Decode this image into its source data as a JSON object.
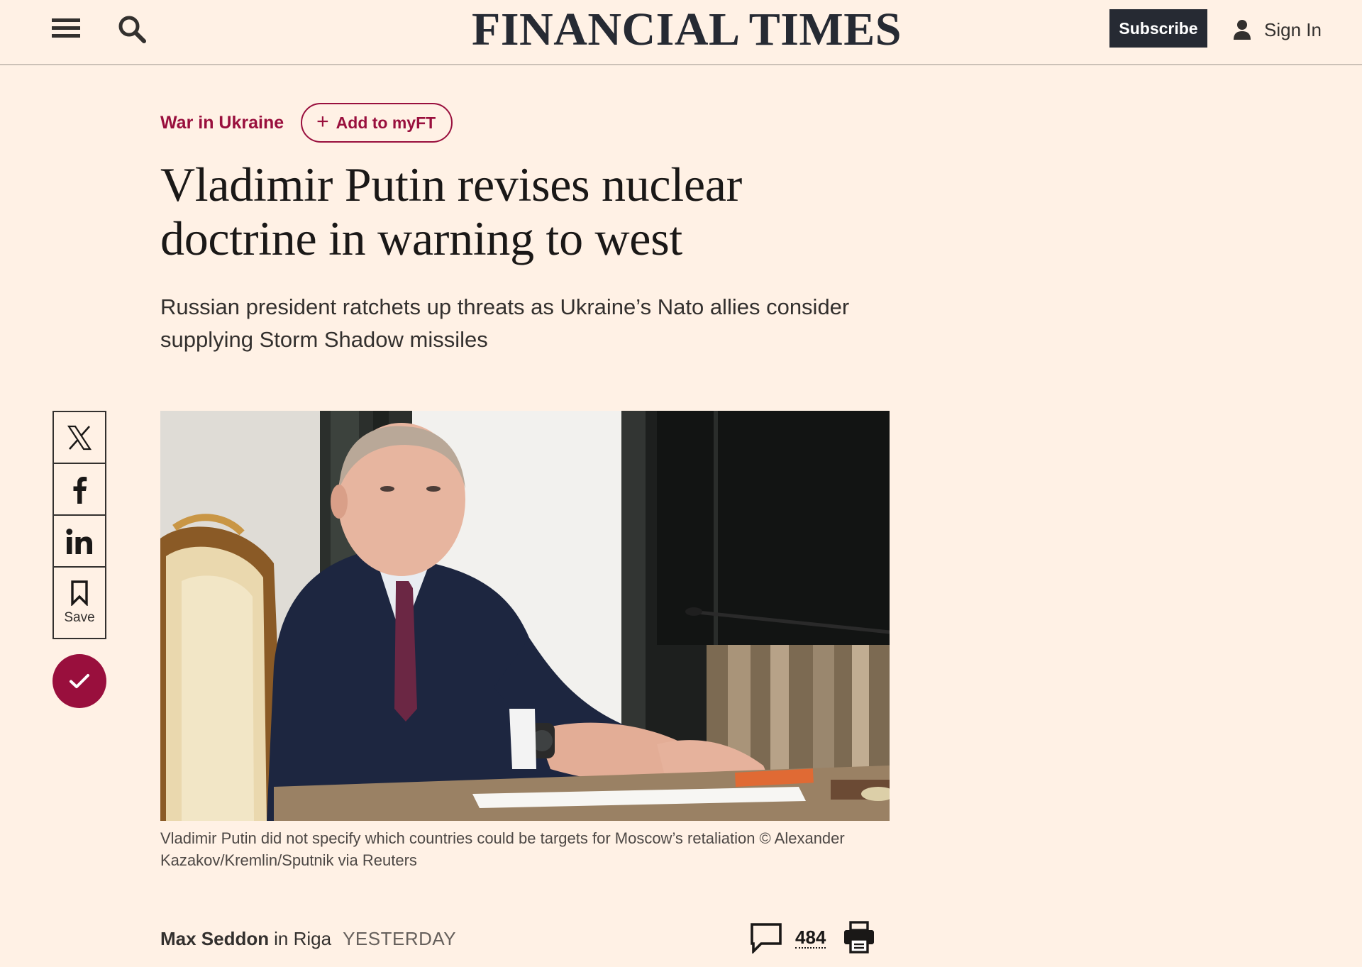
{
  "header": {
    "menu_icon": "hamburger-icon",
    "search_icon": "search-icon",
    "logo": "FINANCIAL TIMES",
    "subscribe_label": "Subscribe",
    "signin_label": "Sign In",
    "user_icon": "user-icon"
  },
  "article": {
    "topic": "War in Ukraine",
    "add_myft_label": "Add to myFT",
    "headline": "Vladimir Putin revises nuclear doctrine in warning to west",
    "standfirst": "Russian president ratchets up threats as Ukraine’s Nato allies consider supplying Storm Shadow missiles",
    "image_alt": "Vladimir Putin seated at a desk",
    "caption": "Vladimir Putin did not specify which countries could be targets for Moscow’s retaliation © Alexander Kazakov/Kremlin/Sputnik via Reuters",
    "author": "Max Seddon",
    "location": "in Riga",
    "date": "YESTERDAY",
    "comment_count": "484"
  },
  "share": {
    "x_icon": "x-icon",
    "facebook_icon": "facebook-icon",
    "linkedin_icon": "linkedin-icon",
    "save_icon": "bookmark-icon",
    "save_label": "Save",
    "follow_icon": "check-icon"
  },
  "colors": {
    "background": "#FFF1E5",
    "accent": "#990f3d",
    "dark": "#262a33"
  }
}
